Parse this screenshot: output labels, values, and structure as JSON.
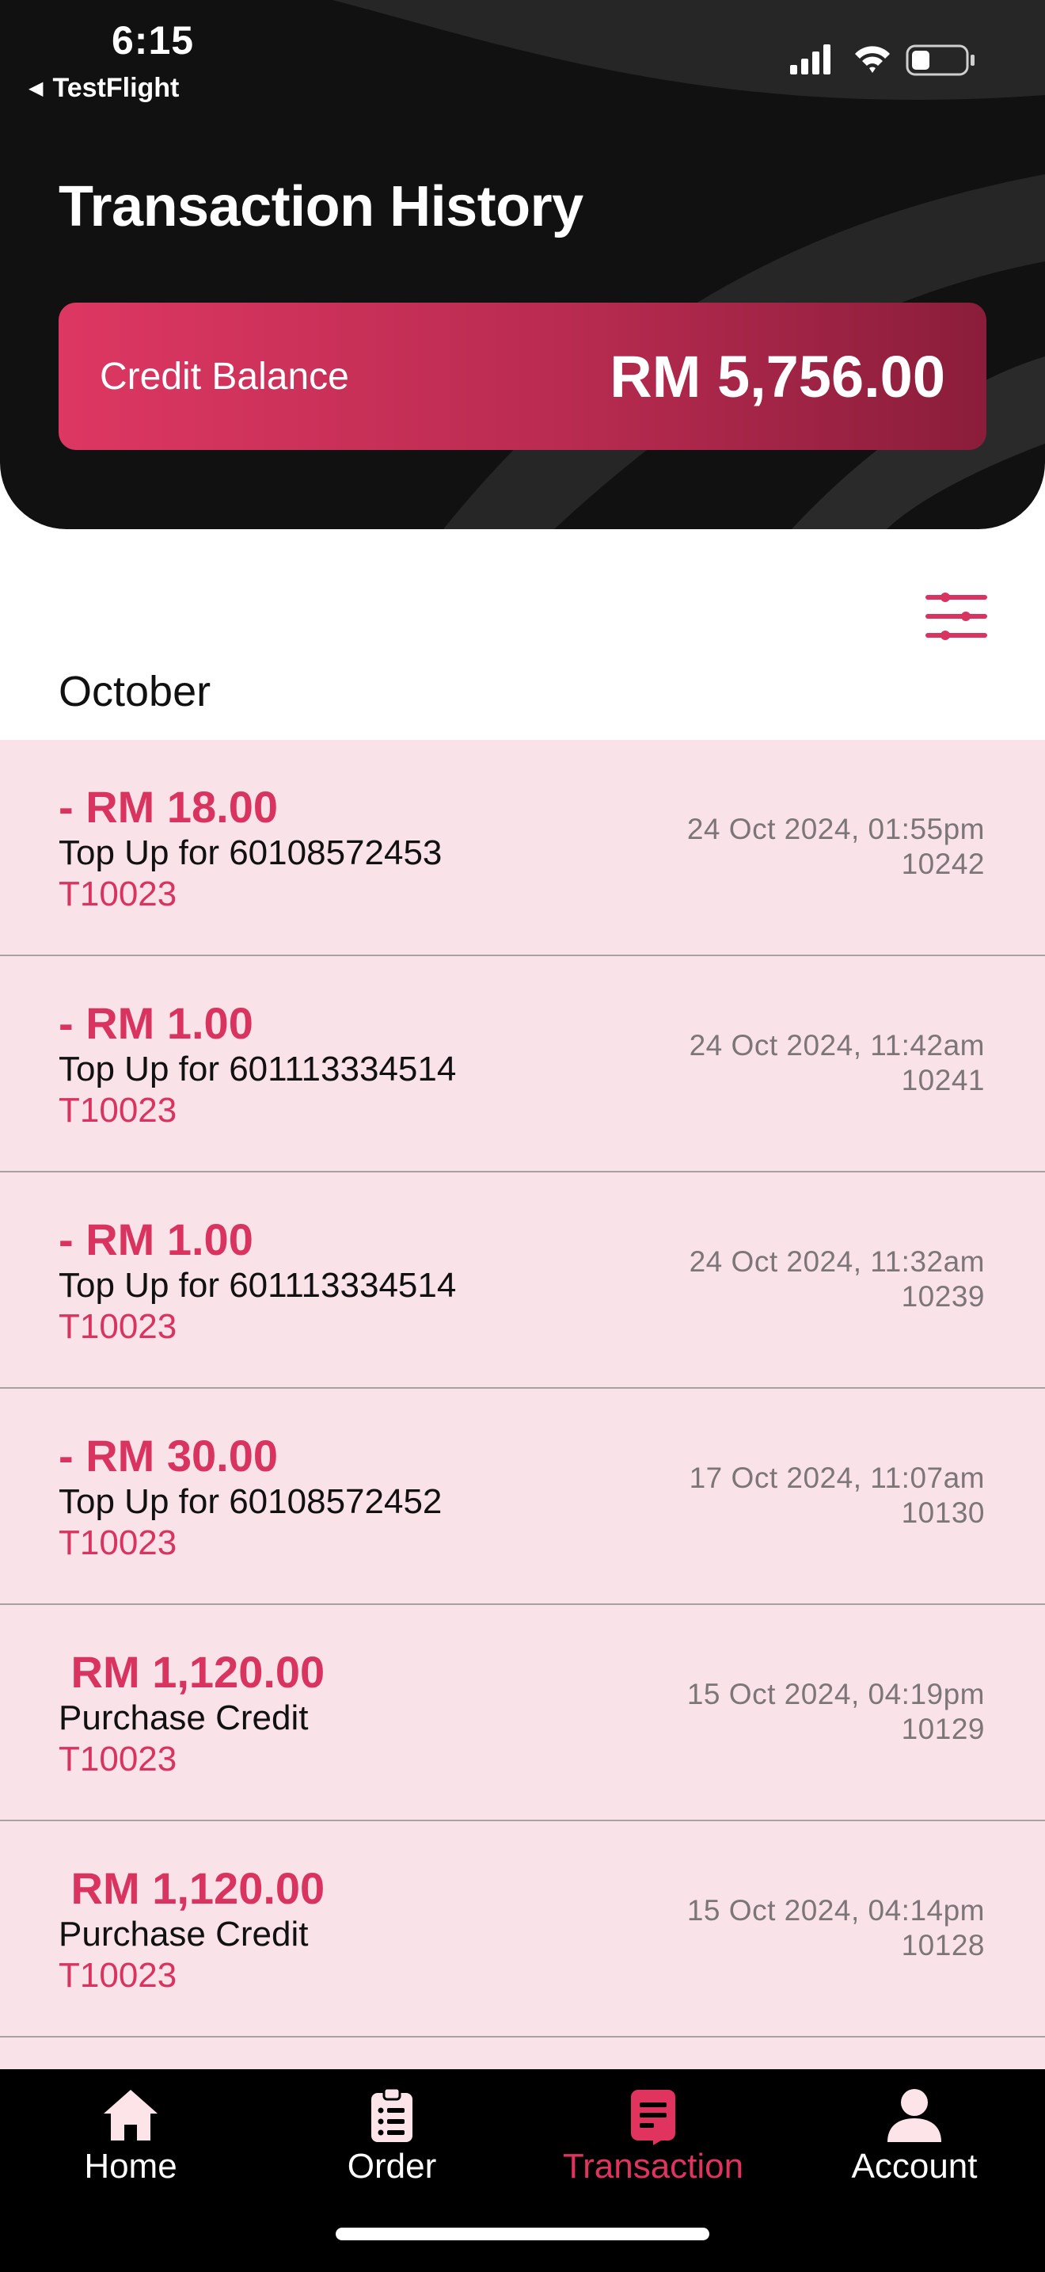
{
  "status_bar": {
    "time": "6:15",
    "back_app": "TestFlight",
    "icons": [
      "cellular-signal-icon",
      "wifi-icon",
      "battery-icon"
    ]
  },
  "header": {
    "title": "Transaction History",
    "balance_label": "Credit Balance",
    "balance_amount": "RM 5,756.00"
  },
  "filter": {
    "icon": "filter-sliders-icon"
  },
  "month": "October",
  "transactions": [
    {
      "amount": "- RM 18.00",
      "description": "Top Up for 60108572453",
      "code": "T10023",
      "datetime": "24 Oct 2024, 01:55pm",
      "id": "10242"
    },
    {
      "amount": "- RM 1.00",
      "description": "Top Up for 601113334514",
      "code": "T10023",
      "datetime": "24 Oct 2024, 11:42am",
      "id": "10241"
    },
    {
      "amount": "- RM 1.00",
      "description": "Top Up for 601113334514",
      "code": "T10023",
      "datetime": "24 Oct 2024, 11:32am",
      "id": "10239"
    },
    {
      "amount": "- RM 30.00",
      "description": "Top Up for 60108572452",
      "code": "T10023",
      "datetime": "17 Oct 2024, 11:07am",
      "id": "10130"
    },
    {
      "amount": " RM 1,120.00",
      "description": "Purchase Credit",
      "code": "T10023",
      "datetime": "15 Oct 2024, 04:19pm",
      "id": "10129"
    },
    {
      "amount": " RM 1,120.00",
      "description": "Purchase Credit",
      "code": "T10023",
      "datetime": "15 Oct 2024, 04:14pm",
      "id": "10128"
    }
  ],
  "nav": {
    "items": [
      {
        "label": "Home",
        "icon": "home-icon"
      },
      {
        "label": "Order",
        "icon": "clipboard-list-icon"
      },
      {
        "label": "Transaction",
        "icon": "receipt-icon",
        "active": true
      },
      {
        "label": "Account",
        "icon": "user-icon"
      }
    ]
  },
  "colors": {
    "accent": "#d9335f",
    "row_background": "#f9e2e8",
    "header_background": "#111111",
    "nav_background": "#000000",
    "nav_active": "#e0345f",
    "nav_icon_inactive": "#fde4e8"
  }
}
